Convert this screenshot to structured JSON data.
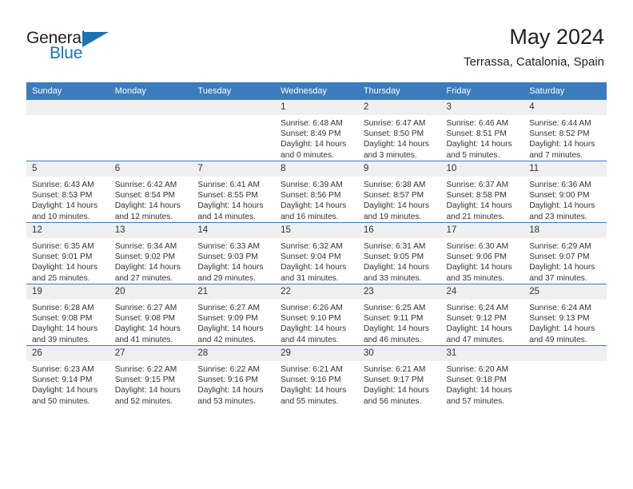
{
  "brand": {
    "name_part1": "General",
    "name_part2": "Blue"
  },
  "header": {
    "title": "May 2024",
    "subtitle": "Terrassa, Catalonia, Spain"
  },
  "colors": {
    "header_blue": "#3a7cbe",
    "brand_blue": "#1b72b8",
    "daynum_bg": "#efefef",
    "text": "#333333"
  },
  "weekdays": [
    "Sunday",
    "Monday",
    "Tuesday",
    "Wednesday",
    "Thursday",
    "Friday",
    "Saturday"
  ],
  "weeks": [
    [
      {
        "day": "",
        "sunrise": "",
        "sunset": "",
        "daylight": ""
      },
      {
        "day": "",
        "sunrise": "",
        "sunset": "",
        "daylight": ""
      },
      {
        "day": "",
        "sunrise": "",
        "sunset": "",
        "daylight": ""
      },
      {
        "day": "1",
        "sunrise": "Sunrise: 6:48 AM",
        "sunset": "Sunset: 8:49 PM",
        "daylight": "Daylight: 14 hours and 0 minutes."
      },
      {
        "day": "2",
        "sunrise": "Sunrise: 6:47 AM",
        "sunset": "Sunset: 8:50 PM",
        "daylight": "Daylight: 14 hours and 3 minutes."
      },
      {
        "day": "3",
        "sunrise": "Sunrise: 6:46 AM",
        "sunset": "Sunset: 8:51 PM",
        "daylight": "Daylight: 14 hours and 5 minutes."
      },
      {
        "day": "4",
        "sunrise": "Sunrise: 6:44 AM",
        "sunset": "Sunset: 8:52 PM",
        "daylight": "Daylight: 14 hours and 7 minutes."
      }
    ],
    [
      {
        "day": "5",
        "sunrise": "Sunrise: 6:43 AM",
        "sunset": "Sunset: 8:53 PM",
        "daylight": "Daylight: 14 hours and 10 minutes."
      },
      {
        "day": "6",
        "sunrise": "Sunrise: 6:42 AM",
        "sunset": "Sunset: 8:54 PM",
        "daylight": "Daylight: 14 hours and 12 minutes."
      },
      {
        "day": "7",
        "sunrise": "Sunrise: 6:41 AM",
        "sunset": "Sunset: 8:55 PM",
        "daylight": "Daylight: 14 hours and 14 minutes."
      },
      {
        "day": "8",
        "sunrise": "Sunrise: 6:39 AM",
        "sunset": "Sunset: 8:56 PM",
        "daylight": "Daylight: 14 hours and 16 minutes."
      },
      {
        "day": "9",
        "sunrise": "Sunrise: 6:38 AM",
        "sunset": "Sunset: 8:57 PM",
        "daylight": "Daylight: 14 hours and 19 minutes."
      },
      {
        "day": "10",
        "sunrise": "Sunrise: 6:37 AM",
        "sunset": "Sunset: 8:58 PM",
        "daylight": "Daylight: 14 hours and 21 minutes."
      },
      {
        "day": "11",
        "sunrise": "Sunrise: 6:36 AM",
        "sunset": "Sunset: 9:00 PM",
        "daylight": "Daylight: 14 hours and 23 minutes."
      }
    ],
    [
      {
        "day": "12",
        "sunrise": "Sunrise: 6:35 AM",
        "sunset": "Sunset: 9:01 PM",
        "daylight": "Daylight: 14 hours and 25 minutes."
      },
      {
        "day": "13",
        "sunrise": "Sunrise: 6:34 AM",
        "sunset": "Sunset: 9:02 PM",
        "daylight": "Daylight: 14 hours and 27 minutes."
      },
      {
        "day": "14",
        "sunrise": "Sunrise: 6:33 AM",
        "sunset": "Sunset: 9:03 PM",
        "daylight": "Daylight: 14 hours and 29 minutes."
      },
      {
        "day": "15",
        "sunrise": "Sunrise: 6:32 AM",
        "sunset": "Sunset: 9:04 PM",
        "daylight": "Daylight: 14 hours and 31 minutes."
      },
      {
        "day": "16",
        "sunrise": "Sunrise: 6:31 AM",
        "sunset": "Sunset: 9:05 PM",
        "daylight": "Daylight: 14 hours and 33 minutes."
      },
      {
        "day": "17",
        "sunrise": "Sunrise: 6:30 AM",
        "sunset": "Sunset: 9:06 PM",
        "daylight": "Daylight: 14 hours and 35 minutes."
      },
      {
        "day": "18",
        "sunrise": "Sunrise: 6:29 AM",
        "sunset": "Sunset: 9:07 PM",
        "daylight": "Daylight: 14 hours and 37 minutes."
      }
    ],
    [
      {
        "day": "19",
        "sunrise": "Sunrise: 6:28 AM",
        "sunset": "Sunset: 9:08 PM",
        "daylight": "Daylight: 14 hours and 39 minutes."
      },
      {
        "day": "20",
        "sunrise": "Sunrise: 6:27 AM",
        "sunset": "Sunset: 9:08 PM",
        "daylight": "Daylight: 14 hours and 41 minutes."
      },
      {
        "day": "21",
        "sunrise": "Sunrise: 6:27 AM",
        "sunset": "Sunset: 9:09 PM",
        "daylight": "Daylight: 14 hours and 42 minutes."
      },
      {
        "day": "22",
        "sunrise": "Sunrise: 6:26 AM",
        "sunset": "Sunset: 9:10 PM",
        "daylight": "Daylight: 14 hours and 44 minutes."
      },
      {
        "day": "23",
        "sunrise": "Sunrise: 6:25 AM",
        "sunset": "Sunset: 9:11 PM",
        "daylight": "Daylight: 14 hours and 46 minutes."
      },
      {
        "day": "24",
        "sunrise": "Sunrise: 6:24 AM",
        "sunset": "Sunset: 9:12 PM",
        "daylight": "Daylight: 14 hours and 47 minutes."
      },
      {
        "day": "25",
        "sunrise": "Sunrise: 6:24 AM",
        "sunset": "Sunset: 9:13 PM",
        "daylight": "Daylight: 14 hours and 49 minutes."
      }
    ],
    [
      {
        "day": "26",
        "sunrise": "Sunrise: 6:23 AM",
        "sunset": "Sunset: 9:14 PM",
        "daylight": "Daylight: 14 hours and 50 minutes."
      },
      {
        "day": "27",
        "sunrise": "Sunrise: 6:22 AM",
        "sunset": "Sunset: 9:15 PM",
        "daylight": "Daylight: 14 hours and 52 minutes."
      },
      {
        "day": "28",
        "sunrise": "Sunrise: 6:22 AM",
        "sunset": "Sunset: 9:16 PM",
        "daylight": "Daylight: 14 hours and 53 minutes."
      },
      {
        "day": "29",
        "sunrise": "Sunrise: 6:21 AM",
        "sunset": "Sunset: 9:16 PM",
        "daylight": "Daylight: 14 hours and 55 minutes."
      },
      {
        "day": "30",
        "sunrise": "Sunrise: 6:21 AM",
        "sunset": "Sunset: 9:17 PM",
        "daylight": "Daylight: 14 hours and 56 minutes."
      },
      {
        "day": "31",
        "sunrise": "Sunrise: 6:20 AM",
        "sunset": "Sunset: 9:18 PM",
        "daylight": "Daylight: 14 hours and 57 minutes."
      },
      {
        "day": "",
        "sunrise": "",
        "sunset": "",
        "daylight": ""
      }
    ]
  ]
}
